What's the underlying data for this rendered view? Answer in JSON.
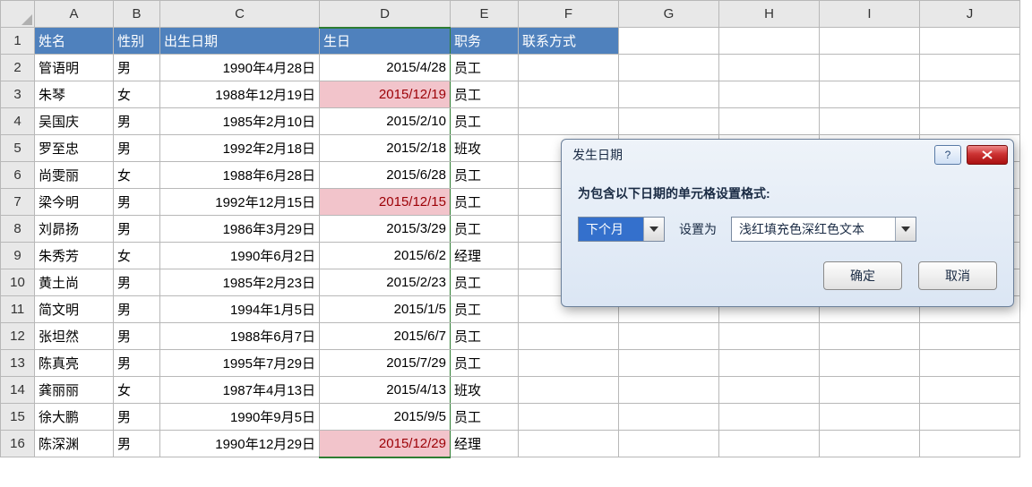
{
  "columns": [
    "A",
    "B",
    "C",
    "D",
    "E",
    "F",
    "G",
    "H",
    "I",
    "J"
  ],
  "headers": {
    "A": "姓名",
    "B": "性别",
    "C": "出生日期",
    "D": "生日",
    "E": "职务",
    "F": "联系方式"
  },
  "rows": [
    {
      "n": "2",
      "A": "管语明",
      "B": "男",
      "C": "1990年4月28日",
      "D": "2015/4/28",
      "E": "员工",
      "hl": false
    },
    {
      "n": "3",
      "A": "朱琴",
      "B": "女",
      "C": "1988年12月19日",
      "D": "2015/12/19",
      "E": "员工",
      "hl": true
    },
    {
      "n": "4",
      "A": "吴国庆",
      "B": "男",
      "C": "1985年2月10日",
      "D": "2015/2/10",
      "E": "员工",
      "hl": false
    },
    {
      "n": "5",
      "A": "罗至忠",
      "B": "男",
      "C": "1992年2月18日",
      "D": "2015/2/18",
      "E": "班攻",
      "hl": false
    },
    {
      "n": "6",
      "A": "尚雯丽",
      "B": "女",
      "C": "1988年6月28日",
      "D": "2015/6/28",
      "E": "员工",
      "hl": false
    },
    {
      "n": "7",
      "A": "梁今明",
      "B": "男",
      "C": "1992年12月15日",
      "D": "2015/12/15",
      "E": "员工",
      "hl": true
    },
    {
      "n": "8",
      "A": "刘昴扬",
      "B": "男",
      "C": "1986年3月29日",
      "D": "2015/3/29",
      "E": "员工",
      "hl": false
    },
    {
      "n": "9",
      "A": "朱秀芳",
      "B": "女",
      "C": "1990年6月2日",
      "D": "2015/6/2",
      "E": "经理",
      "hl": false
    },
    {
      "n": "10",
      "A": "黄土尚",
      "B": "男",
      "C": "1985年2月23日",
      "D": "2015/2/23",
      "E": "员工",
      "hl": false
    },
    {
      "n": "11",
      "A": "简文明",
      "B": "男",
      "C": "1994年1月5日",
      "D": "2015/1/5",
      "E": "员工",
      "hl": false
    },
    {
      "n": "12",
      "A": "张坦然",
      "B": "男",
      "C": "1988年6月7日",
      "D": "2015/6/7",
      "E": "员工",
      "hl": false
    },
    {
      "n": "13",
      "A": "陈真亮",
      "B": "男",
      "C": "1995年7月29日",
      "D": "2015/7/29",
      "E": "员工",
      "hl": false
    },
    {
      "n": "14",
      "A": "龚丽丽",
      "B": "女",
      "C": "1987年4月13日",
      "D": "2015/4/13",
      "E": "班攻",
      "hl": false
    },
    {
      "n": "15",
      "A": "徐大鹏",
      "B": "男",
      "C": "1990年9月5日",
      "D": "2015/9/5",
      "E": "员工",
      "hl": false
    },
    {
      "n": "16",
      "A": "陈深渊",
      "B": "男",
      "C": "1990年12月29日",
      "D": "2015/12/29",
      "E": "经理",
      "hl": true
    }
  ],
  "dialog": {
    "title": "发生日期",
    "label": "为包含以下日期的单元格设置格式:",
    "period": "下个月",
    "mid": "设置为",
    "format": "浅红填充色深红色文本",
    "ok": "确定",
    "cancel": "取消",
    "help_symbol": "?"
  }
}
